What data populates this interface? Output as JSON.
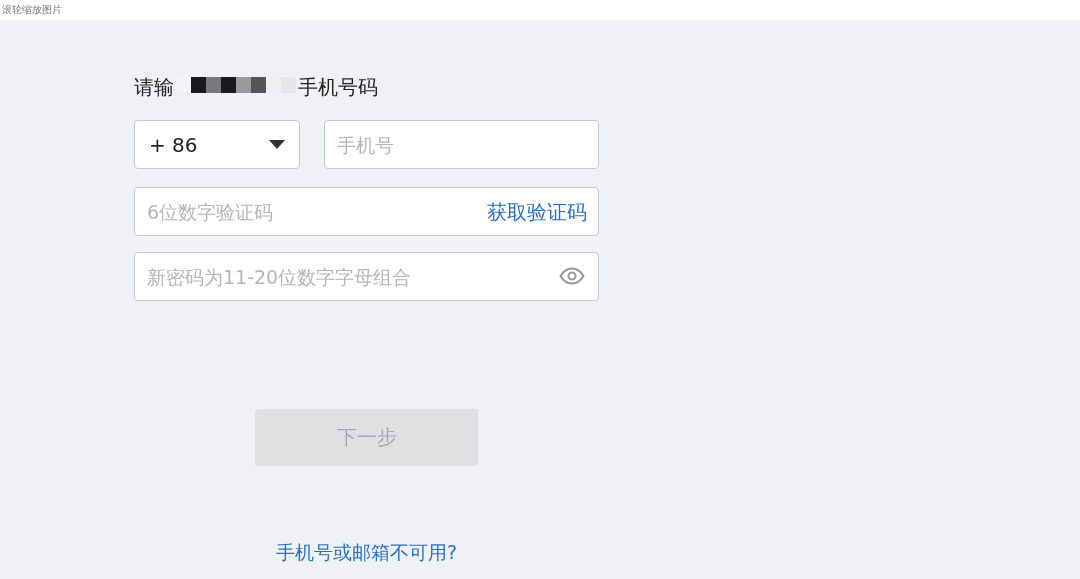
{
  "top_bar": {
    "hint": "滚轮缩放图片"
  },
  "title": {
    "start": "请输",
    "end": "手机号码",
    "redacted": true
  },
  "country_code": {
    "value": "+ 86"
  },
  "phone": {
    "placeholder": "手机号"
  },
  "code": {
    "placeholder": "6位数字验证码",
    "action": "获取验证码"
  },
  "password": {
    "placeholder": "新密码为11-20位数字字母组合"
  },
  "next_button": {
    "label": "下一步",
    "disabled": true
  },
  "help_link": "手机号或邮箱不可用?"
}
